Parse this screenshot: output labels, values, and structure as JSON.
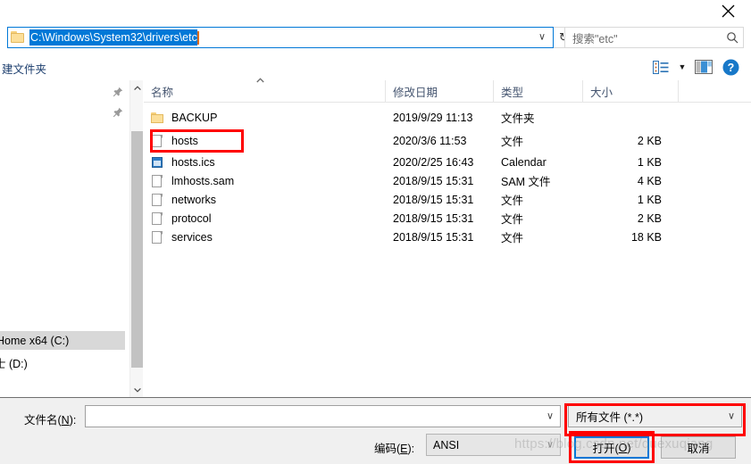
{
  "window": {
    "close_label": "✕"
  },
  "address": {
    "path": "C:\\Windows\\System32\\drivers\\etc",
    "chevron": "∨",
    "refresh_icon": "↻"
  },
  "search": {
    "placeholder": "搜索\"etc\"",
    "icon": "search-icon"
  },
  "toolbar": {
    "new_folder_label": "建文件夹",
    "view_dropdown_arrow": "▼",
    "help_label": "?"
  },
  "nav": {
    "items": [
      {
        "label": "Home x64 (C:)",
        "selected": true
      },
      {
        "label": "士 (D:)",
        "selected": false
      }
    ],
    "pin_icon": "📌"
  },
  "filelist": {
    "columns": [
      {
        "label": "名称"
      },
      {
        "label": "修改日期"
      },
      {
        "label": "类型"
      },
      {
        "label": "大小"
      }
    ],
    "sort_caret": "▲",
    "rows": [
      {
        "name": "BACKUP",
        "icon": "folder-icon",
        "date": "2019/9/29 11:13",
        "type": "文件夹",
        "size": ""
      },
      {
        "name": "hosts",
        "icon": "file-icon",
        "date": "2020/3/6 11:53",
        "type": "文件",
        "size": "2 KB"
      },
      {
        "name": "hosts.ics",
        "icon": "calendar-icon",
        "date": "2020/2/25 16:43",
        "type": "Calendar",
        "size": "1 KB"
      },
      {
        "name": "lmhosts.sam",
        "icon": "file-icon",
        "date": "2018/9/15 15:31",
        "type": "SAM 文件",
        "size": "4 KB"
      },
      {
        "name": "networks",
        "icon": "file-icon",
        "date": "2018/9/15 15:31",
        "type": "文件",
        "size": "1 KB"
      },
      {
        "name": "protocol",
        "icon": "file-icon",
        "date": "2018/9/15 15:31",
        "type": "文件",
        "size": "2 KB"
      },
      {
        "name": "services",
        "icon": "file-icon",
        "date": "2018/9/15 15:31",
        "type": "文件",
        "size": "18 KB"
      }
    ]
  },
  "footer": {
    "filename_label_pre": "文件名(",
    "filename_label_key": "N",
    "filename_label_post": "):",
    "filename_value": "",
    "filetype_value": "所有文件  (*.*)",
    "filetype_chevron": "∨",
    "encoding_label_pre": "编码(",
    "encoding_label_key": "E",
    "encoding_label_post": "):",
    "encoding_value": "ANSI",
    "encoding_chevron": "∨",
    "open_pre": "打开(",
    "open_key": "O",
    "open_post": ")",
    "cancel_label": "取消"
  },
  "watermark": {
    "text": "https://blog.csdn.net/quexuqiang"
  },
  "colors": {
    "accent": "#0078d7",
    "annotation": "#ff0000",
    "folder": "#fcdf9a",
    "header_text": "#44546f"
  }
}
